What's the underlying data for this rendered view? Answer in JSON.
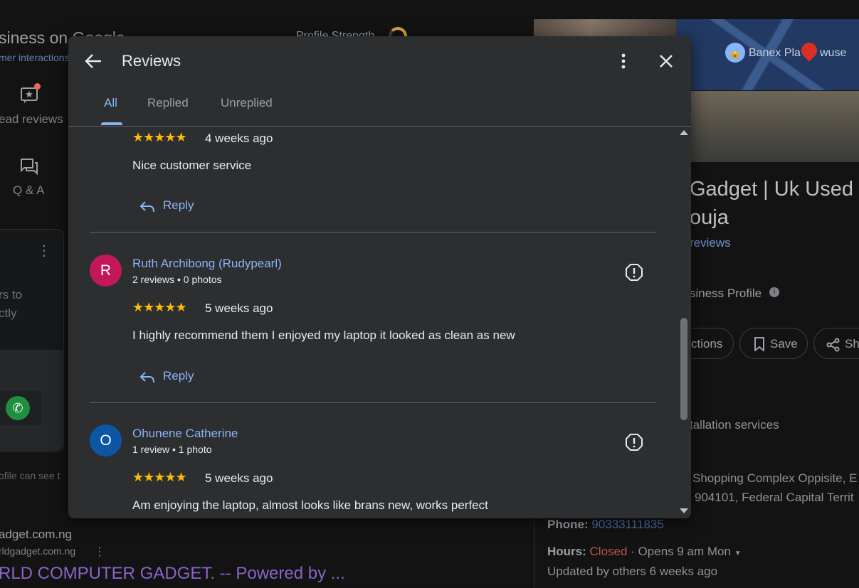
{
  "background": {
    "page_title": "siness on Google",
    "page_subtitle": "mer interactions",
    "profile_strength": "Profile Strength",
    "nav": [
      {
        "label": "ead reviews",
        "icon": "review-star-icon"
      },
      {
        "label": "Q & A",
        "icon": "qa-chat-icon"
      }
    ],
    "card_text_1": "rs to",
    "card_text_2": "ctly",
    "footer_note": "ofile can see t",
    "url_1": "adget.com.ng",
    "url_2": "rldgadget.com.ng",
    "link_title": "RLD COMPUTER GADGET. -- Powered by ...",
    "map_label_1": "Banex Pla",
    "map_label_2": "wuse",
    "business_name_1": "Gadget | Uk Used",
    "business_name_2": "ouja",
    "reviews_link": "reviews",
    "business_profile": "siness Profile",
    "chips": [
      "ctions",
      "Save",
      "Sh"
    ],
    "service": "tallation services",
    "address_1": "Shopping Complex Oppisite, E",
    "address_2": "904101, Federal Capital Territ",
    "phone_label": "Phone:",
    "phone": "90333111835",
    "hours_label": "Hours:",
    "hours_status": "Closed",
    "hours_detail": "· Opens 9 am Mon",
    "updated": "Updated by others 6 weeks ago"
  },
  "dialog": {
    "title": "Reviews",
    "tabs": [
      {
        "label": "All",
        "active": true
      },
      {
        "label": "Replied",
        "active": false
      },
      {
        "label": "Unreplied",
        "active": false
      }
    ],
    "reply_label": "Reply",
    "reviews": [
      {
        "stars": "★★★★★",
        "time": "4 weeks ago",
        "text": "Nice customer service"
      },
      {
        "initial": "R",
        "avatar_color": "#c2185b",
        "name": "Ruth Archibong (Rudypearl)",
        "meta": "2 reviews • 0 photos",
        "stars": "★★★★★",
        "time": "5 weeks ago",
        "text": "I highly recommend them I enjoyed my laptop it looked as clean as new"
      },
      {
        "initial": "O",
        "avatar_color": "#0b57a4",
        "name": "Ohunene Catherine",
        "meta": "1 review • 1 photo",
        "stars": "★★★★★",
        "time": "5 weeks ago",
        "text": "Am enjoying the laptop, almost looks like brans new, works perfect"
      }
    ]
  },
  "colors": {
    "accent": "#8ab4f8",
    "star": "#fbbc04",
    "dialog_bg": "#2d2e30"
  }
}
